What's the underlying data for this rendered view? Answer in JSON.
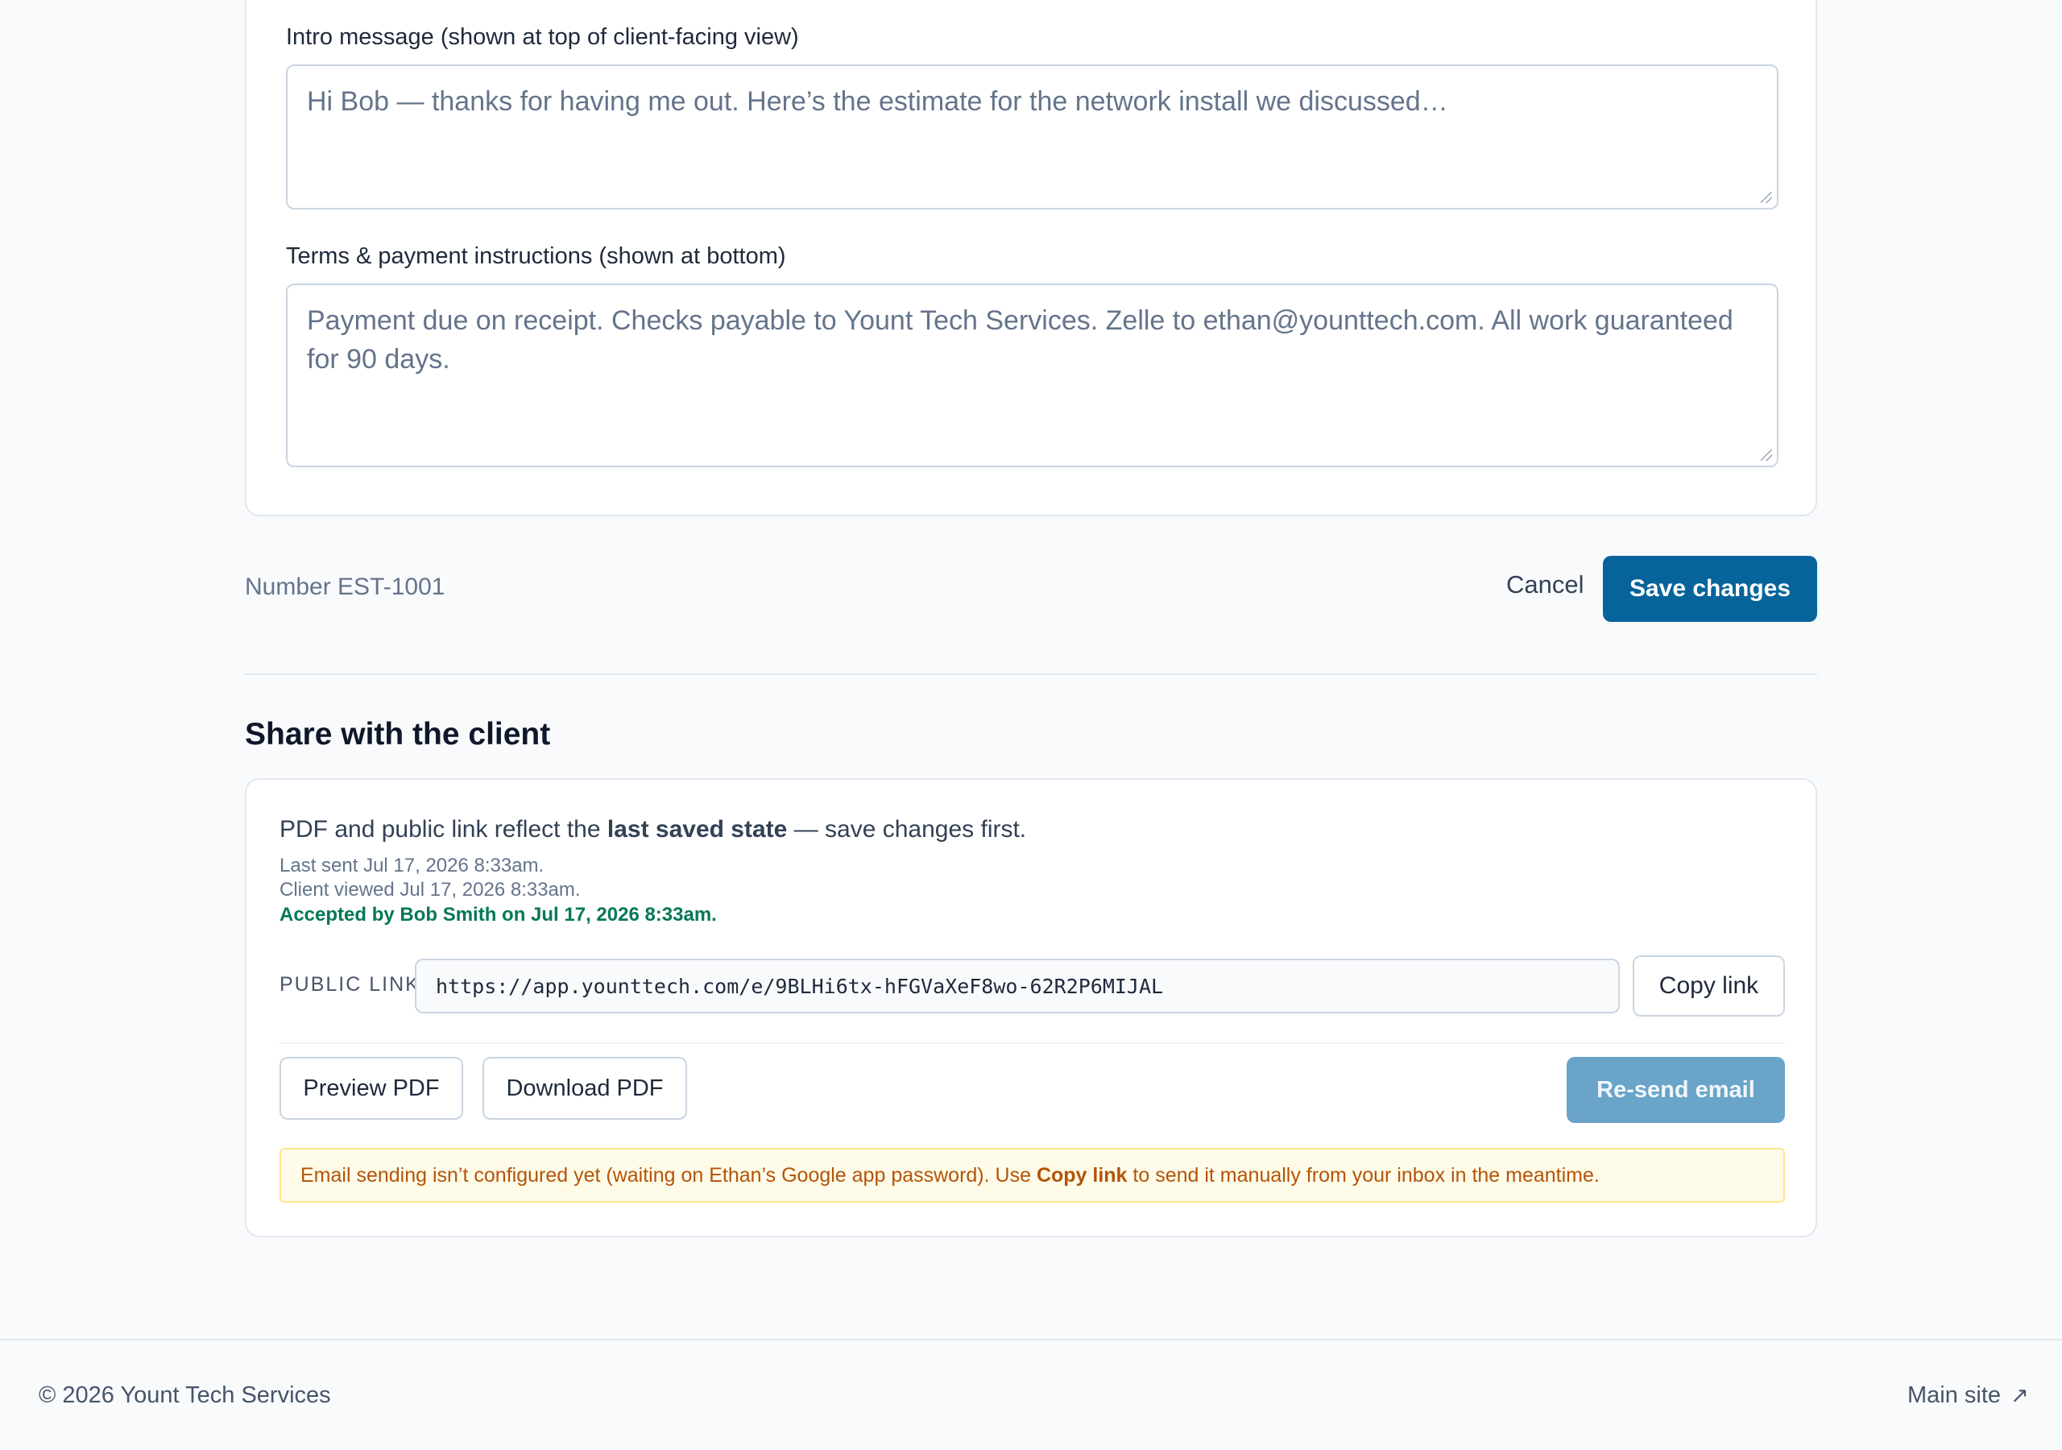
{
  "form": {
    "intro_label": "Intro message (shown at top of client-facing view)",
    "intro_value": "Hi Bob — thanks for having me out. Here’s the estimate for the network install we discussed…",
    "terms_label": "Terms & payment instructions (shown at bottom)",
    "terms_value": "Payment due on receipt. Checks payable to Yount Tech Services. Zelle to ethan@younttech.com. All work guaranteed for 90 days."
  },
  "actions": {
    "number": "Number EST-1001",
    "cancel_label": "Cancel",
    "save_label": "Save changes"
  },
  "share": {
    "title": "Share with the client",
    "note_prefix": "PDF and public link reflect the",
    "note_strong": "last saved state",
    "note_suffix": "— save changes first.",
    "last_sent": "Last sent Jul 17, 2026 8:33am.",
    "client_viewed": "Client viewed Jul 17, 2026 8:33am.",
    "accepted": "Accepted by Bob Smith on Jul 17, 2026 8:33am.",
    "public_link_label": "PUBLIC LINK",
    "public_link_url": "https://app.younttech.com/e/9BLHi6tx-hFGVaXeF8wo-62R2P6MIJAL",
    "copy_link_label": "Copy link",
    "preview_pdf_label": "Preview PDF",
    "download_pdf_label": "Download PDF",
    "resend_email_label": "Re-send email",
    "warning_prefix": "Email sending isn’t configured yet (waiting on Ethan’s Google app password). Use",
    "warning_strong": "Copy link",
    "warning_suffix": "to send it manually from your inbox in the meantime."
  },
  "footer": {
    "copyright": "© 2026 Yount Tech Services",
    "main_site_label": "Main site",
    "main_site_icon": "↗"
  },
  "colors": {
    "primary": "#07649b",
    "primary_disabled": "#6aa4c8",
    "success_text": "#047857",
    "warning_text": "#b45309",
    "warning_bg": "#fefce8"
  }
}
